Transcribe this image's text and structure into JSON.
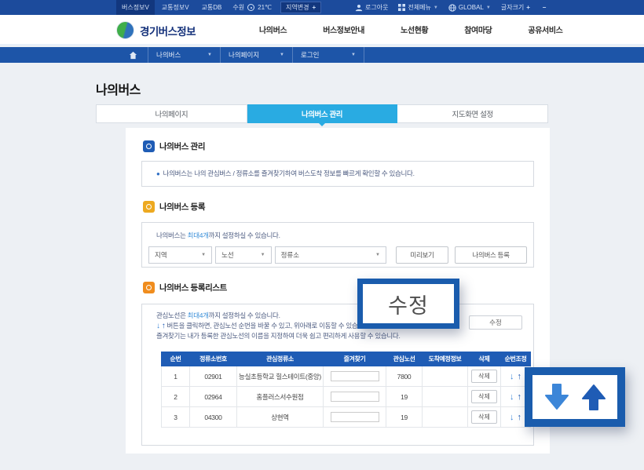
{
  "topbar": {
    "items_left": [
      {
        "label": "버스정보V"
      },
      {
        "label": "교통정보V"
      },
      {
        "label": "교통DB"
      },
      {
        "label": "수원"
      },
      {
        "label": "21℃"
      },
      {
        "label": "지역변경"
      }
    ],
    "logout_label": "로그아웃",
    "allmenu_label": "전체메뉴",
    "global_label": "GLOBAL",
    "fontsize_label": "글자크기",
    "plus": "+",
    "minus": "−"
  },
  "header": {
    "logo_text": "경기버스정보",
    "nav": [
      {
        "label": "나의버스"
      },
      {
        "label": "버스정보안내"
      },
      {
        "label": "노선현황"
      },
      {
        "label": "참여마당"
      },
      {
        "label": "공유서비스"
      }
    ]
  },
  "breadcrumb": {
    "items": [
      {
        "label": "나의버스"
      },
      {
        "label": "나의페이지"
      },
      {
        "label": "로그인"
      }
    ]
  },
  "page": {
    "title": "나의버스"
  },
  "tabs": [
    {
      "label": "나의페이지"
    },
    {
      "label": "나의버스 관리"
    },
    {
      "label": "지도화면 설정"
    }
  ],
  "section_manage": {
    "title": "나의버스 관리",
    "note": "나의버스는 나의 관심버스 / 정류소를 즐겨찾기하여 버스도착 정보를 빠르게 확인할 수 있습니다."
  },
  "section_register": {
    "title": "나의버스 등록",
    "note_prefix": "나의버스는 ",
    "note_highlight": "최대4개",
    "note_suffix": "까지 설정하실 수 있습니다.",
    "select_region": "지역",
    "select_route": "노선",
    "select_stop": "정류소",
    "preview_button": "미리보기",
    "register_button": "나의버스 등록"
  },
  "section_list": {
    "title": "나의버스 등록리스트",
    "note1_prefix": "관심노선은 ",
    "note1_highlight": "최대4개",
    "note1_suffix": "까지 설정하실 수 있습니다.",
    "note2": "버튼을 클릭하면, 관심노선 순번을 바꿀 수 있고, 위아래로 이동할 수 있습니다.",
    "note3": "즐겨찾기는 내가 등록한 관심노선의 이름을 지정하여 더욱 쉽고 편리하게 사용할 수 있습니다.",
    "edit_button": "수정"
  },
  "table": {
    "headers": [
      "순번",
      "정류소번호",
      "관심정류소",
      "즐겨찾기",
      "관심노선",
      "도착예정정보",
      "삭제",
      "순번조정"
    ],
    "delete_label": "삭제",
    "rows": [
      {
        "no": "1",
        "stop_no": "02901",
        "stop_name": "능실초등학교 힐스테이트(중앙)",
        "favorite": "",
        "route": "7800",
        "arrival": ""
      },
      {
        "no": "2",
        "stop_no": "02964",
        "stop_name": "홈플러스서수원점",
        "favorite": "",
        "route": "19",
        "arrival": ""
      },
      {
        "no": "3",
        "stop_no": "04300",
        "stop_name": "상현역",
        "favorite": "",
        "route": "19",
        "arrival": ""
      }
    ]
  },
  "callouts": {
    "edit_label": "수정"
  },
  "colors": {
    "topbar": "#1c4b9c",
    "breadcrumb": "#1d55a8",
    "active_tab": "#29abe2",
    "table_header": "#1f5cb5",
    "callout_border": "#1a5cad",
    "link_blue": "#3a8fd8",
    "arrow_down": "#3c86d8",
    "arrow_up": "#1f5cb5"
  }
}
